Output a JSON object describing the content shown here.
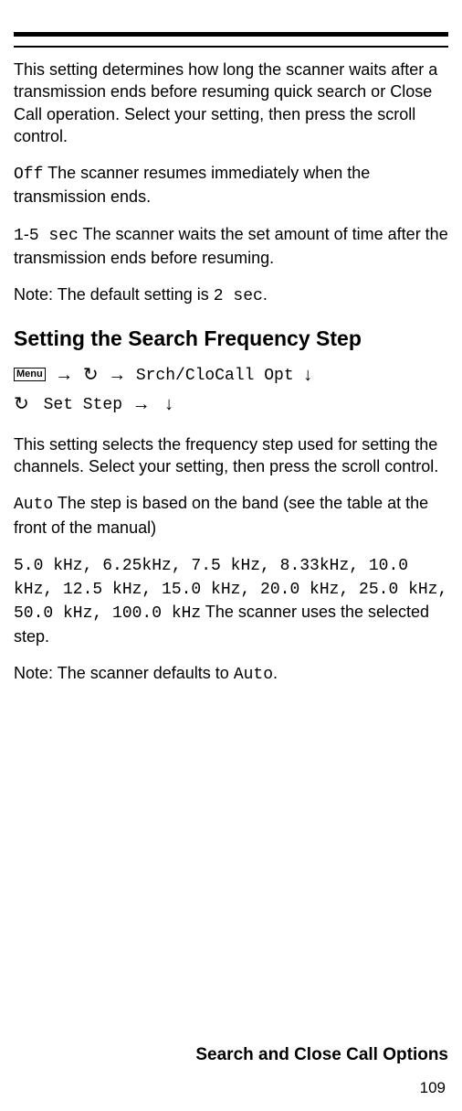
{
  "para1": "This setting determines how long the scanner waits after a transmission ends before resuming quick search or Close Call operation. Select your setting, then press the scroll control.",
  "off_label": "Off",
  "off_desc": " The scanner resumes immediately when the transmission ends.",
  "range_label_1": "1",
  "range_dash": "-",
  "range_label_5": "5 sec",
  "range_desc": " The scanner waits the set amount of time after the transmission ends before resuming.",
  "note1_prefix": "Note: The default setting is ",
  "note1_value": "2 sec",
  "note1_suffix": ".",
  "heading": "Setting the Search Frequency Step",
  "menu_label": "Menu",
  "nav_opt": "Srch/CloCall Opt",
  "nav_setstep": "Set Step",
  "para2": "This setting selects the frequency step used for setting the channels. Select your setting, then press the scroll control.",
  "auto_label": "Auto",
  "auto_desc": " The step is based on the band (see the table at the front of the manual)",
  "steps_list": "5.0 kHz, 6.25kHz, 7.5 kHz, 8.33kHz, 10.0 kHz, 12.5 kHz, 15.0 kHz, 20.0 kHz, 25.0 kHz, 50.0 kHz, 100.0 kHz",
  "steps_desc": "  The scanner uses the selected step.",
  "note2_prefix": "Note: The scanner defaults to ",
  "note2_value": "Auto",
  "note2_suffix": ".",
  "footer": "Search and Close Call Options",
  "page_number": "109"
}
